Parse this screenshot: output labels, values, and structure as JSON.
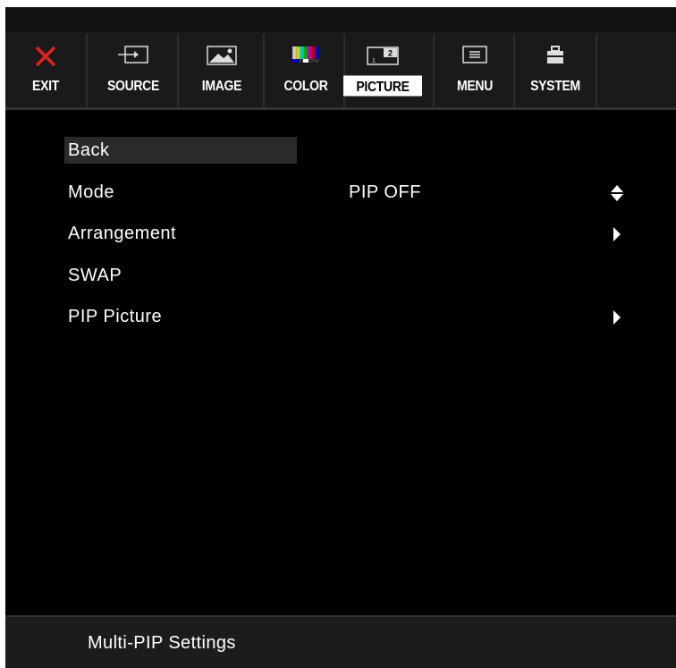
{
  "tabs": [
    {
      "label": "EXIT",
      "icon": "close-icon",
      "active": false
    },
    {
      "label": "SOURCE",
      "icon": "source-icon",
      "active": false
    },
    {
      "label": "IMAGE",
      "icon": "image-icon",
      "active": false
    },
    {
      "label": "COLOR",
      "icon": "color-bars-icon",
      "active": false
    },
    {
      "label": "PICTURE",
      "icon": "pip-icon",
      "active": true
    },
    {
      "label": "MENU",
      "icon": "menu-icon",
      "active": false
    },
    {
      "label": "SYSTEM",
      "icon": "system-icon",
      "active": false
    }
  ],
  "menu": {
    "items": [
      {
        "label": "Back",
        "value": "",
        "indicator": "none",
        "selected": true
      },
      {
        "label": "Mode",
        "value": "PIP OFF",
        "indicator": "up-down",
        "selected": false
      },
      {
        "label": "Arrangement",
        "value": "",
        "indicator": "right",
        "selected": false
      },
      {
        "label": "SWAP",
        "value": "",
        "indicator": "none",
        "selected": false
      },
      {
        "label": "PIP Picture",
        "value": "",
        "indicator": "right",
        "selected": false
      }
    ]
  },
  "footer": {
    "title": "Multi-PIP Settings"
  },
  "colors": {
    "background": "#000000",
    "exit_icon": "#e0231c",
    "text": "#ffffff",
    "active_tab_bg": "#ffffff",
    "color_bars": [
      "#c8c8c8",
      "#d8d000",
      "#00c8c8",
      "#00b000",
      "#c000c0",
      "#c00000",
      "#0000c0"
    ]
  }
}
